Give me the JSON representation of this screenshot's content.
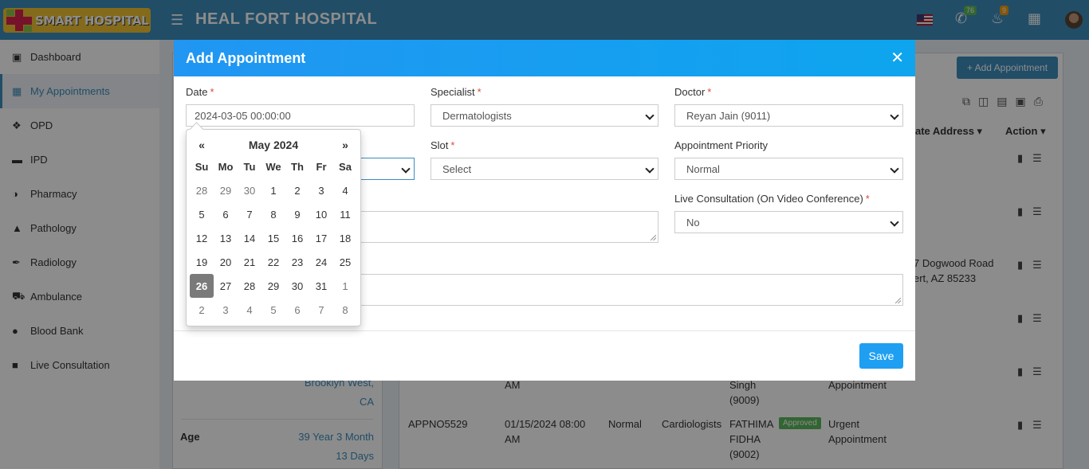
{
  "header": {
    "logo_text": "SMART HOSPITAL",
    "hospital_name": "HEAL FORT HOSPITAL",
    "whatsapp_badge": "76",
    "notification_badge": "9"
  },
  "sidebar": {
    "items": [
      {
        "label": "Dashboard",
        "icon": "monitor-icon"
      },
      {
        "label": "My Appointments",
        "icon": "hospital-icon"
      },
      {
        "label": "OPD",
        "icon": "stethoscope-icon"
      },
      {
        "label": "IPD",
        "icon": "bed-icon"
      },
      {
        "label": "Pharmacy",
        "icon": "mortar-icon"
      },
      {
        "label": "Pathology",
        "icon": "flask-icon"
      },
      {
        "label": "Radiology",
        "icon": "microscope-icon"
      },
      {
        "label": "Ambulance",
        "icon": "ambulance-icon"
      },
      {
        "label": "Blood Bank",
        "icon": "drop-icon"
      },
      {
        "label": "Live Consultation",
        "icon": "video-icon"
      }
    ]
  },
  "background": {
    "add_appointment_button": "+ Add Appointment",
    "col_alternate_address": "rnate Address",
    "col_action": "Action",
    "address_line1": "7 Dogwood Road",
    "address_line2": "ert, AZ 85233",
    "profile_city": "Brooklyn West,",
    "profile_state": "CA",
    "age_label": "Age",
    "age_value1": "39 Year 3 Month",
    "age_value2": "13 Days",
    "row1_time": "AM",
    "row1_doctor_line1": "Singh",
    "row1_doctor_line2": "(9009)",
    "row1_type": "Appointment",
    "row2_no": "APPNO5529",
    "row2_date": "01/15/2024 08:00",
    "row2_time": "AM",
    "row2_priority": "Normal",
    "row2_specialist": "Cardiologists",
    "row2_doctor_line1": "FATHIMA",
    "row2_doctor_line2": "FIDHA",
    "row2_doctor_line3": "(9002)",
    "row2_status": "Approved",
    "row2_type_line1": "Urgent",
    "row2_type_line2": "Appointment"
  },
  "modal": {
    "title": "Add Appointment",
    "date_label": "Date",
    "date_value": "2024-03-05 00:00:00",
    "specialist_label": "Specialist",
    "specialist_value": "Dermatologists",
    "doctor_label": "Doctor",
    "doctor_value": "Reyan Jain (9011)",
    "slot_label": "Slot",
    "slot_value": "Select",
    "priority_label": "Appointment Priority",
    "priority_value": "Normal",
    "live_label": "Live Consultation (On Video Conference)",
    "live_value": "No",
    "save_label": "Save",
    "required_mark": "*"
  },
  "datepicker": {
    "month_title": "May 2024",
    "prev": "«",
    "next": "»",
    "weekdays": [
      "Su",
      "Mo",
      "Tu",
      "We",
      "Th",
      "Fr",
      "Sa"
    ],
    "weeks": [
      [
        "28",
        "29",
        "30",
        "1",
        "2",
        "3",
        "4"
      ],
      [
        "5",
        "6",
        "7",
        "8",
        "9",
        "10",
        "11"
      ],
      [
        "12",
        "13",
        "14",
        "15",
        "16",
        "17",
        "18"
      ],
      [
        "19",
        "20",
        "21",
        "22",
        "23",
        "24",
        "25"
      ],
      [
        "26",
        "27",
        "28",
        "29",
        "30",
        "31",
        "1"
      ],
      [
        "2",
        "3",
        "4",
        "5",
        "6",
        "7",
        "8"
      ]
    ],
    "selected": "26"
  }
}
